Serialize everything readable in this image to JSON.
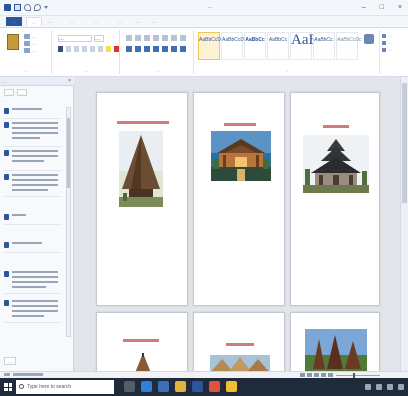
{
  "window": {
    "title": "…",
    "controls": [
      "–",
      "□",
      "×"
    ]
  },
  "ribbon": {
    "tabs": [
      {
        "label": "…",
        "active": false
      },
      {
        "label": "…",
        "active": true
      },
      {
        "label": "…",
        "active": false
      },
      {
        "label": "…",
        "active": false
      },
      {
        "label": "…",
        "active": false
      },
      {
        "label": "…",
        "active": false
      },
      {
        "label": "…",
        "active": false
      },
      {
        "label": "…",
        "active": false
      }
    ],
    "clipboard": {
      "lines": [
        "…",
        "…",
        "…"
      ],
      "group_label": "…"
    },
    "font": {
      "family": "…",
      "size": "…",
      "group_label": "…"
    },
    "paragraph": {
      "group_label": "…"
    },
    "styles": {
      "items": [
        {
          "sample": "AaBbCcDc",
          "name": "…",
          "selected": true
        },
        {
          "sample": "AaBbCcDc",
          "name": "…",
          "selected": false
        },
        {
          "sample": "AaBbCc",
          "name": "…",
          "selected": false
        },
        {
          "sample": "AaBbCc",
          "name": "…",
          "selected": false
        },
        {
          "sample": "AaB",
          "name": "…",
          "selected": false,
          "large": true
        },
        {
          "sample": "AaBbCc.",
          "name": "…",
          "selected": false
        },
        {
          "sample": "AaBbCcDc",
          "name": "…",
          "selected": false
        }
      ],
      "group_label": "…",
      "change_styles": "…"
    },
    "editing": {
      "items": [
        "…",
        "…",
        "…"
      ],
      "group_label": "…"
    }
  },
  "clipboard_pane": {
    "title": "…",
    "buttons": [
      "…",
      "…"
    ],
    "hint": "…",
    "items": [
      {
        "icon": "word-clip-icon"
      },
      {
        "icon": "word-clip-icon"
      },
      {
        "icon": "word-clip-icon"
      },
      {
        "icon": "word-clip-icon"
      },
      {
        "icon": "word-clip-icon"
      },
      {
        "icon": "word-clip-icon"
      },
      {
        "icon": "word-clip-icon"
      },
      {
        "icon": "word-clip-icon"
      }
    ],
    "options_button": "…"
  },
  "document": {
    "pages": [
      {
        "images": [
          {
            "subject": "thatched-cone-house"
          }
        ]
      },
      {
        "images": [
          {
            "subject": "pendopo-pavilion"
          }
        ]
      },
      {
        "images": [
          {
            "subject": "tiered-roof-mosque"
          }
        ]
      },
      {
        "images": [
          {
            "subject": "traditional-roof"
          }
        ]
      },
      {
        "images": [
          {
            "subject": "thatched-roof-houses"
          }
        ]
      },
      {
        "images": [
          {
            "subject": "conical-roof-houses"
          }
        ]
      }
    ]
  },
  "taskbar": {
    "search_placeholder": "Type here to search",
    "apps": [
      "file-explorer-icon",
      "edge-icon",
      "store-icon",
      "mail-icon",
      "word-icon",
      "chrome-icon",
      "paint-icon"
    ]
  },
  "colors": {
    "word_blue": "#2b579a",
    "heading_red": "#c0504d",
    "taskbar": "#1f2a3a"
  }
}
